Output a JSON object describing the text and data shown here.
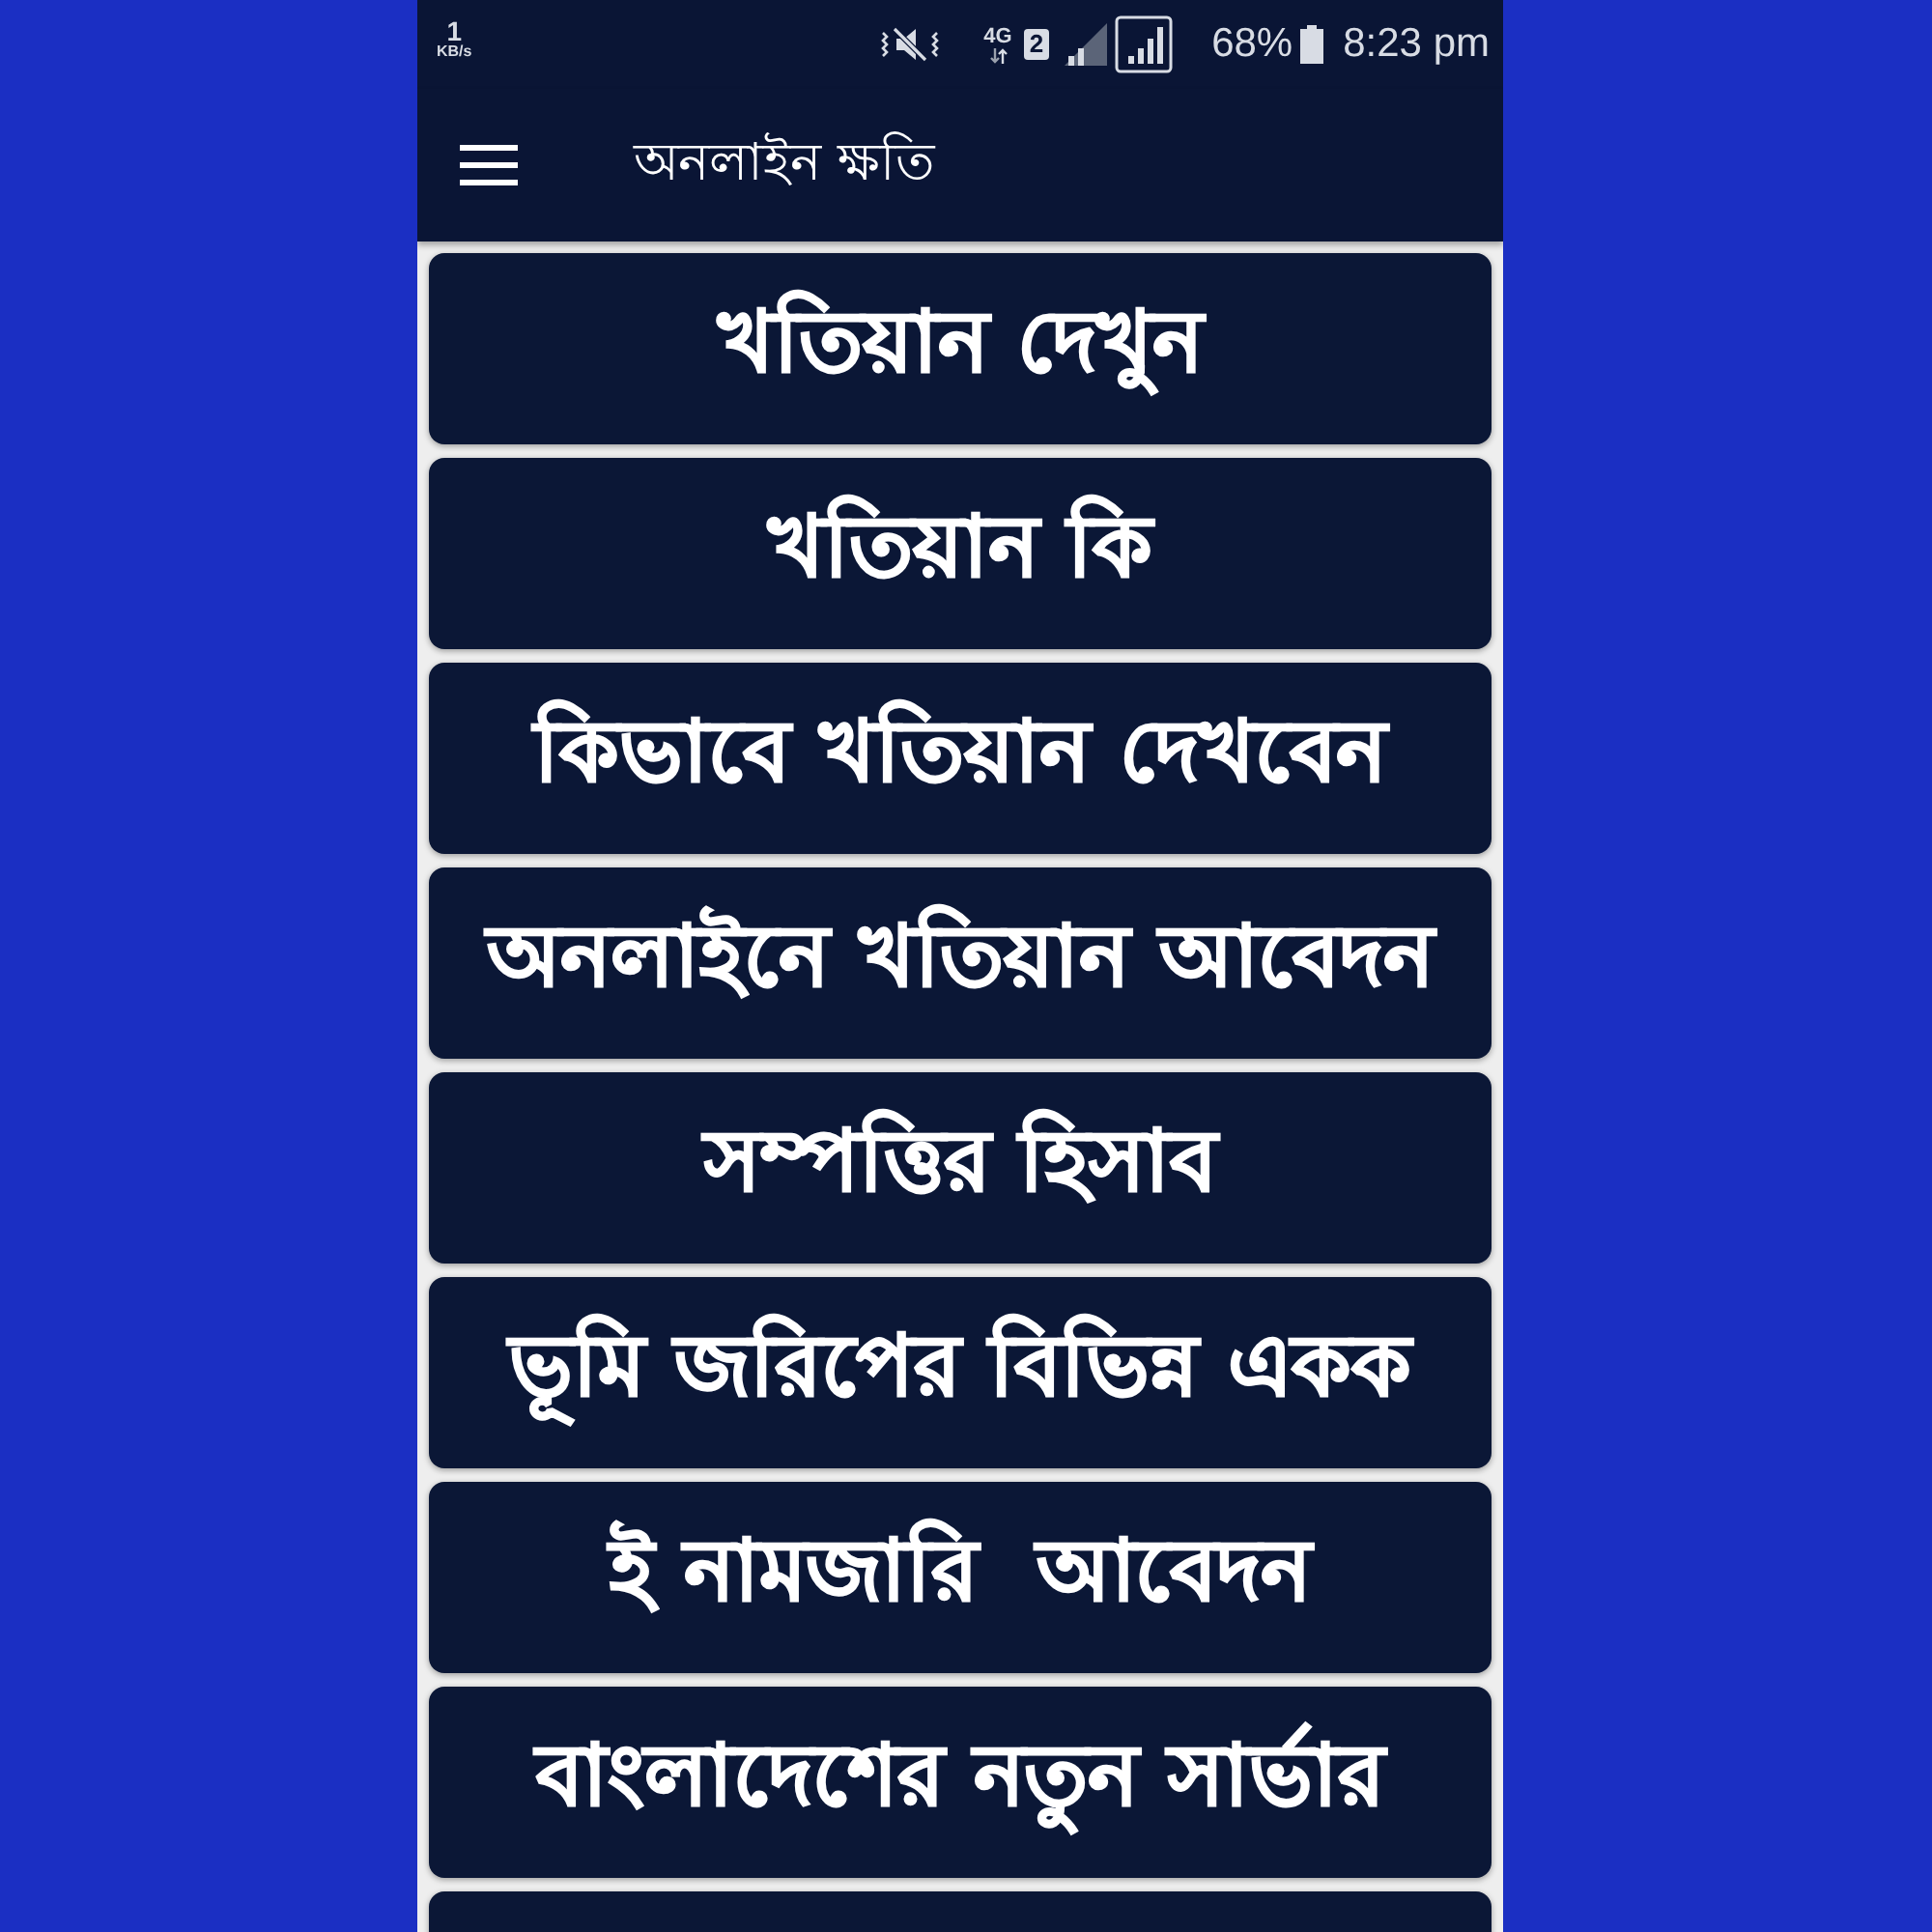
{
  "status_bar": {
    "data_rate_value": "1",
    "data_rate_unit": "KB/s",
    "network": "4G",
    "sim": "2",
    "battery": "68%",
    "time": "8:23 pm"
  },
  "app_bar": {
    "title": "অনলাইন ক্ষতি"
  },
  "menu": {
    "items": [
      {
        "label": "খতিয়ান দেখুন"
      },
      {
        "label": "খতিয়ান কি"
      },
      {
        "label": "কিভাবে খতিয়ান দেখবেন"
      },
      {
        "label": "অনলাইনে খতিয়ান আবেদন"
      },
      {
        "label": "সম্পত্তির হিসাব"
      },
      {
        "label": "ভূমি জরিপের বিভিন্ন একক"
      },
      {
        "label": "ই নামজারি  আবেদন"
      },
      {
        "label": "বাংলাদেশের নতুন সার্ভার"
      }
    ],
    "more_below": true
  }
}
